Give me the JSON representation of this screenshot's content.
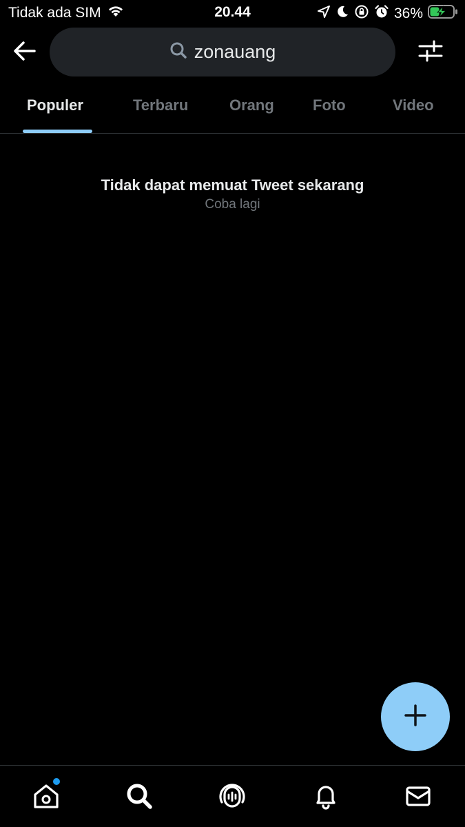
{
  "status_bar": {
    "carrier": "Tidak ada SIM",
    "time": "20.44",
    "battery": "36%",
    "icons": [
      "wifi-icon",
      "location-arrow-icon",
      "moon-icon",
      "rotation-lock-icon",
      "alarm-icon",
      "battery-charging-icon"
    ]
  },
  "header": {
    "back_icon": "arrow-left-icon",
    "search_query": "zonauang",
    "search_icon": "search-icon",
    "filter_icon": "sliders-icon"
  },
  "tabs": [
    {
      "label": "Populer",
      "active": true
    },
    {
      "label": "Terbaru",
      "active": false
    },
    {
      "label": "Orang",
      "active": false
    },
    {
      "label": "Foto",
      "active": false
    },
    {
      "label": "Video",
      "active": false
    }
  ],
  "content": {
    "error_title": "Tidak dapat memuat Tweet sekarang",
    "retry_label": "Coba lagi"
  },
  "fab": {
    "icon": "plus-icon"
  },
  "bottom_nav": [
    {
      "name": "home",
      "icon": "home-icon",
      "has_badge": true
    },
    {
      "name": "search",
      "icon": "search-icon",
      "has_badge": false
    },
    {
      "name": "spaces",
      "icon": "spaces-icon",
      "has_badge": false
    },
    {
      "name": "notifications",
      "icon": "bell-icon",
      "has_badge": false
    },
    {
      "name": "messages",
      "icon": "envelope-icon",
      "has_badge": false
    }
  ],
  "colors": {
    "background": "#000000",
    "accent": "#8ecdf8",
    "badge": "#1d9bf0",
    "text_primary": "#e7e9ea",
    "text_secondary": "#71767b",
    "search_bg": "#202327",
    "divider": "#2f3336"
  }
}
